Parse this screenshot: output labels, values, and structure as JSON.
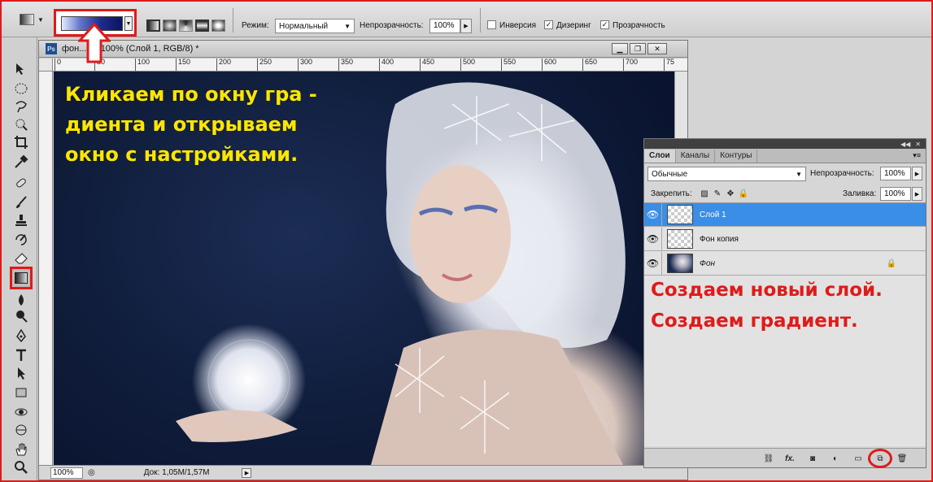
{
  "options_bar": {
    "mode_label": "Режим:",
    "mode_value": "Нормальный",
    "opacity_label": "Непрозрачность:",
    "opacity_value": "100%",
    "inverse_label": "Инверсия",
    "inverse_checked": false,
    "dither_label": "Дизеринг",
    "dither_checked": true,
    "transparency_label": "Прозрачность",
    "transparency_checked": true
  },
  "document": {
    "title": "фон... @ 100% (Слой 1, RGB/8) *",
    "ps_badge": "Ps",
    "ruler_ticks": [
      "0",
      "50",
      "100",
      "150",
      "200",
      "250",
      "300",
      "350",
      "400",
      "450",
      "500",
      "550",
      "600",
      "650",
      "700",
      "75"
    ],
    "zoom": "100%",
    "doc_info": "Док: 1,05M/1,57M"
  },
  "annotations": {
    "yellow_text": "Кликаем по окну гра - диента и открываем окно с настройками.",
    "red_text": "Создаем новый слой. Создаем градиент."
  },
  "layers_panel": {
    "tabs": [
      "Слои",
      "Каналы",
      "Контуры"
    ],
    "blend_mode": "Обычные",
    "opacity_label": "Непрозрачность:",
    "opacity_value": "100%",
    "lock_label": "Закрепить:",
    "fill_label": "Заливка:",
    "fill_value": "100%",
    "layers": [
      {
        "name": "Слой 1",
        "selected": true,
        "thumb": "transparent"
      },
      {
        "name": "Фон копия",
        "selected": false,
        "thumb": "transparent"
      },
      {
        "name": "Фон",
        "selected": false,
        "thumb": "photo",
        "locked": true
      }
    ],
    "bottom_fx": "fx."
  },
  "colors": {
    "annotation_red": "#e01a1a",
    "annotation_yellow": "#ffe600",
    "selection_blue": "#3a8ee6"
  }
}
